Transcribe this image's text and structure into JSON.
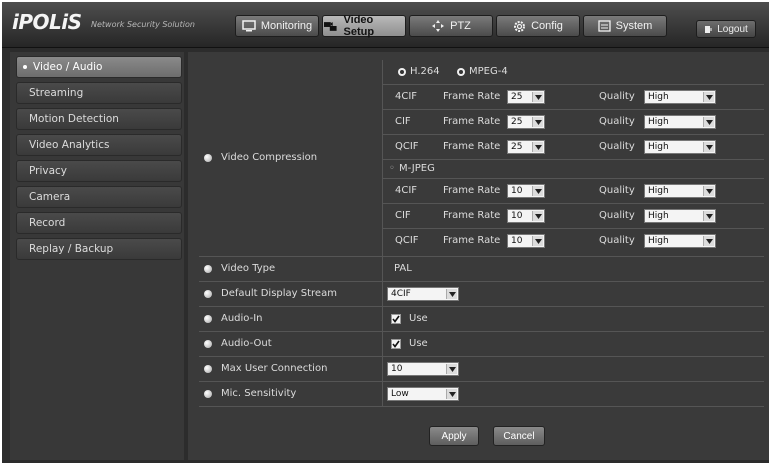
{
  "header": {
    "logo": "iPOLiS",
    "logo_sub": "Network Security Solution",
    "nav": [
      {
        "label": "Monitoring",
        "icon": "monitor-icon"
      },
      {
        "label": "Video Setup",
        "icon": "cameras-icon"
      },
      {
        "label": "PTZ",
        "icon": "ptz-arrows-icon"
      },
      {
        "label": "Config",
        "icon": "gear-icon"
      },
      {
        "label": "System",
        "icon": "system-window-icon"
      }
    ],
    "logout": "Logout"
  },
  "sidebar": {
    "items": [
      {
        "label": "Video / Audio"
      },
      {
        "label": "Streaming"
      },
      {
        "label": "Motion Detection"
      },
      {
        "label": "Video Analytics"
      },
      {
        "label": "Privacy"
      },
      {
        "label": "Camera"
      },
      {
        "label": "Record"
      },
      {
        "label": "Replay / Backup"
      }
    ]
  },
  "compression": {
    "label": "Video Compression",
    "codec_h264": "H.264",
    "codec_mpeg4": "MPEG-4",
    "mjpeg_label": "M-JPEG",
    "frame_rate_label": "Frame Rate",
    "quality_label": "Quality",
    "mpeg4_rows": [
      {
        "res": "4CIF",
        "frame_rate": "25",
        "quality": "High"
      },
      {
        "res": "CIF",
        "frame_rate": "25",
        "quality": "High"
      },
      {
        "res": "QCIF",
        "frame_rate": "25",
        "quality": "High"
      }
    ],
    "mjpeg_rows": [
      {
        "res": "4CIF",
        "frame_rate": "10",
        "quality": "High"
      },
      {
        "res": "CIF",
        "frame_rate": "10",
        "quality": "High"
      },
      {
        "res": "QCIF",
        "frame_rate": "10",
        "quality": "High"
      }
    ]
  },
  "settings": {
    "video_type": {
      "label": "Video Type",
      "value": "PAL"
    },
    "default_stream": {
      "label": "Default Display Stream",
      "value": "4CIF"
    },
    "audio_in": {
      "label": "Audio-In",
      "value": "Use"
    },
    "audio_out": {
      "label": "Audio-Out",
      "value": "Use"
    },
    "max_user": {
      "label": "Max User Connection",
      "value": "10"
    },
    "mic": {
      "label": "Mic. Sensitivity",
      "value": "Low"
    }
  },
  "actions": {
    "apply": "Apply",
    "cancel": "Cancel"
  }
}
